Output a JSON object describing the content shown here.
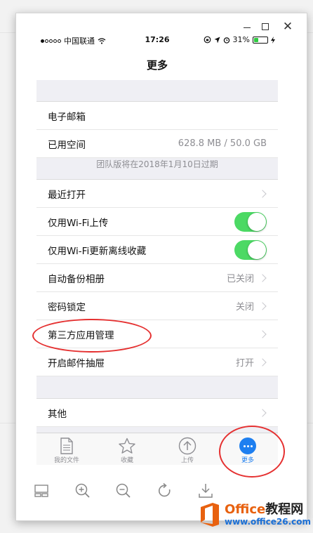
{
  "status_bar": {
    "carrier": "中国联通",
    "time": "17:26",
    "battery_percent": "31%",
    "battery_level": 0.31
  },
  "nav": {
    "title": "更多"
  },
  "account": {
    "email_label": "电子邮箱",
    "storage_label": "已用空间",
    "storage_value": "628.8 MB / 50.0 GB",
    "expire_note": "团队版将在2018年1月10日过期"
  },
  "settings": [
    {
      "label": "最近打开",
      "value": "",
      "type": "chevron"
    },
    {
      "label": "仅用Wi-Fi上传",
      "value": "",
      "type": "toggle",
      "on": true
    },
    {
      "label": "仅用Wi-Fi更新离线收藏",
      "value": "",
      "type": "toggle",
      "on": true
    },
    {
      "label": "自动备份相册",
      "value": "已关闭",
      "type": "chevron"
    },
    {
      "label": "密码锁定",
      "value": "关闭",
      "type": "chevron"
    },
    {
      "label": "第三方应用管理",
      "value": "",
      "type": "chevron"
    },
    {
      "label": "开启邮件抽屉",
      "value": "打开",
      "type": "chevron"
    }
  ],
  "other": {
    "label": "其他"
  },
  "tabs": [
    {
      "label": "我的文件",
      "icon": "file-icon"
    },
    {
      "label": "收藏",
      "icon": "star-icon"
    },
    {
      "label": "上传",
      "icon": "upload-icon"
    },
    {
      "label": "更多",
      "icon": "more-icon",
      "active": true
    }
  ],
  "watermark": {
    "line1_a": "Office",
    "line1_b": "教程网",
    "line2": "www.office26.com"
  },
  "colors": {
    "accent": "#1e7ff0",
    "toggle_on": "#4cd964",
    "annotation": "#e53030"
  }
}
